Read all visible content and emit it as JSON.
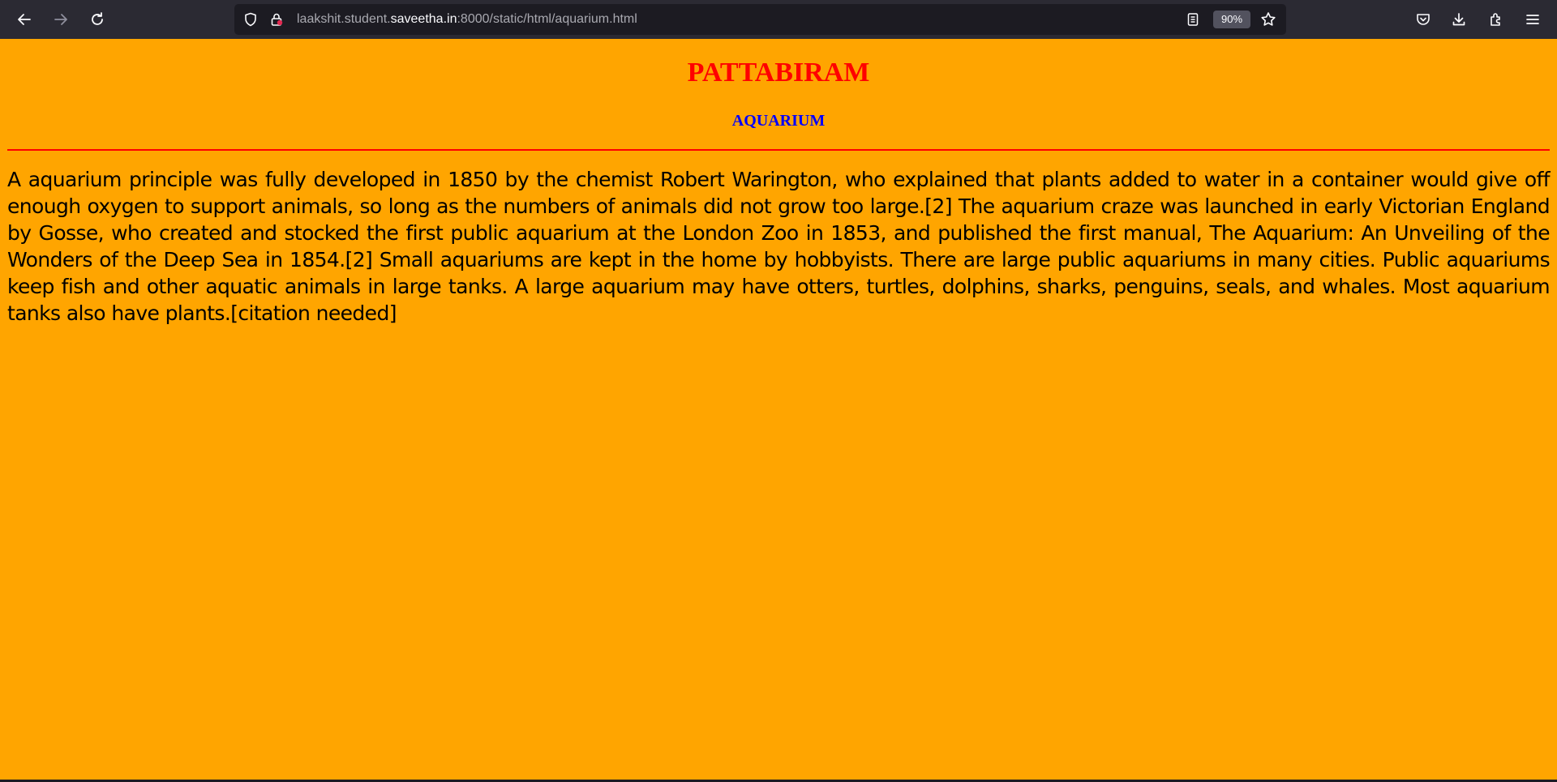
{
  "browser": {
    "url_prefix": "laakshit.student.",
    "url_host": "saveetha.in",
    "url_suffix": ":8000/static/html/aquarium.html",
    "zoom": "90%"
  },
  "page": {
    "title": "PATTABIRAM",
    "subtitle": "AQUARIUM",
    "paragraph": "A aquarium principle was fully developed in 1850 by the chemist Robert Warington, who explained that plants added to water in a container would give off enough oxygen to support animals, so long as the numbers of animals did not grow too large.[2] The aquarium craze was launched in early Victorian England by Gosse, who created and stocked the first public aquarium at the London Zoo in 1853, and published the first manual, The Aquarium: An Unveiling of the Wonders of the Deep Sea in 1854.[2] Small aquariums are kept in the home by hobbyists. There are large public aquariums in many cities. Public aquariums keep fish and other aquatic animals in large tanks. A large aquarium may have otters, turtles, dolphins, sharks, penguins, seals, and whales. Most aquarium tanks also have plants.[citation needed]"
  },
  "colors": {
    "page_background": "#ffa500",
    "title_color": "#ff0000",
    "subtitle_color": "#0000ff",
    "rule_color": "#ff0000",
    "toolbar": "#2b2a33"
  },
  "icons": [
    "back-arrow-icon",
    "forward-arrow-icon",
    "reload-icon",
    "shield-icon",
    "lock-icon",
    "reader-view-icon",
    "bookmark-star-icon",
    "pocket-icon",
    "download-icon",
    "extensions-icon",
    "menu-icon"
  ]
}
